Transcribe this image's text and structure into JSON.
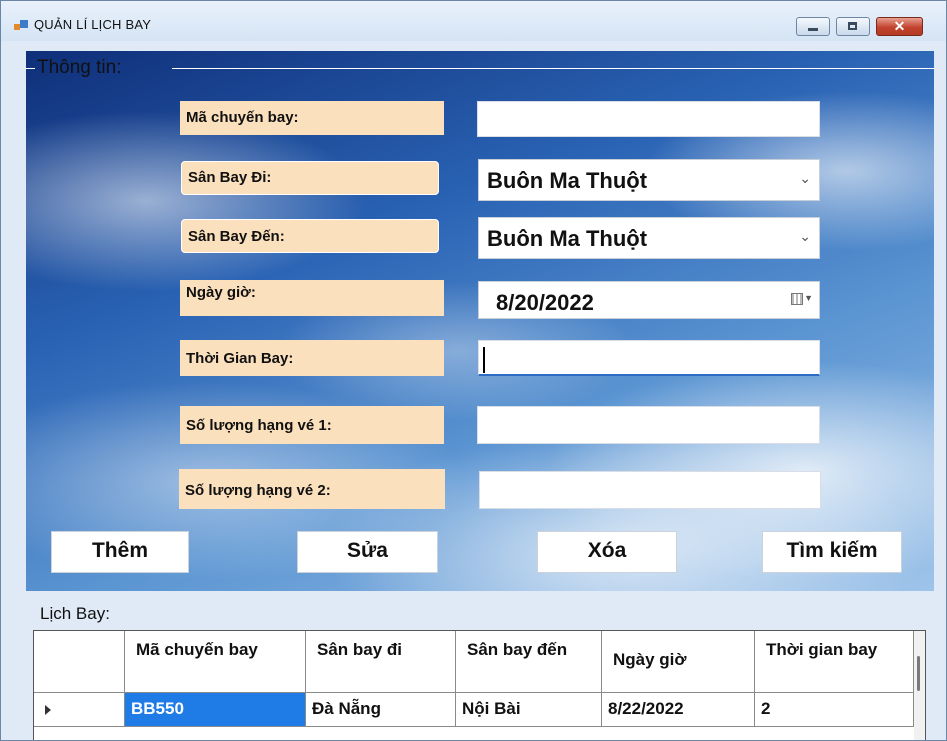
{
  "window": {
    "title": "QUẢN LÍ LỊCH BAY",
    "close_glyph": "✕"
  },
  "info_group": {
    "legend": "Thông tin:",
    "labels": {
      "flight_code": "Mã chuyến bay:",
      "departure_airport": "Sân Bay Đi:",
      "arrival_airport": "Sân Bay Đến:",
      "datetime": "Ngày giờ:",
      "flight_duration": "Thời Gian Bay:",
      "class1_qty": "Số lượng hạng vé 1:",
      "class2_qty": "Số lượng hạng vé 2:"
    },
    "values": {
      "flight_code": "",
      "departure_airport": "Buôn Ma Thuột",
      "arrival_airport": "Buôn Ma Thuột",
      "datetime": "8/20/2022",
      "flight_duration": "",
      "class1_qty": "",
      "class2_qty": ""
    },
    "combo_arrow": "⌄",
    "buttons": {
      "add": "Thêm",
      "edit": "Sửa",
      "delete": "Xóa",
      "search": "Tìm kiếm"
    }
  },
  "schedule_grid": {
    "title": "Lịch Bay:",
    "columns": [
      "Mã chuyến bay",
      "Sân bay đi",
      "Sân bay đến",
      "Ngày giờ",
      "Thời gian bay"
    ],
    "rows": [
      [
        "BB550",
        "Đà Nẵng",
        "Nội Bài",
        "8/22/2022",
        "2"
      ]
    ]
  },
  "icons": [
    "app-icon",
    "minimize-icon",
    "maximize-icon",
    "close-icon",
    "chevron-down-icon",
    "calendar-icon",
    "row-selector-icon"
  ]
}
